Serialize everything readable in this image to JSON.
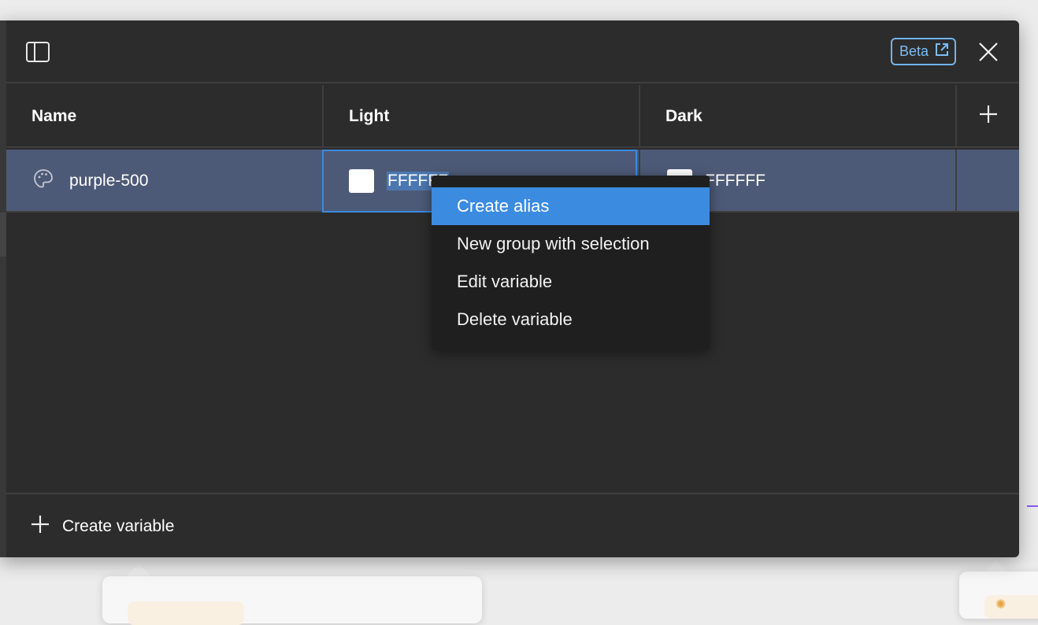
{
  "header": {
    "beta_label": "Beta",
    "icons": {
      "sidebar_toggle": "sidebar-panel-icon",
      "external_link": "external-link-icon",
      "close": "close-icon"
    }
  },
  "table": {
    "columns": [
      {
        "label": "Name"
      },
      {
        "label": "Light"
      },
      {
        "label": "Dark"
      }
    ],
    "add_column_icon": "plus-icon",
    "rows": [
      {
        "icon": "palette-icon",
        "name": "purple-500",
        "light": {
          "swatch_color": "#FFFFFF",
          "value": "FFFFFF"
        },
        "dark": {
          "swatch_color": "#FFFFFF",
          "value": "FFFFFF"
        }
      }
    ]
  },
  "footer": {
    "create_variable_label": "Create variable"
  },
  "context_menu": {
    "items": [
      {
        "label": "Create alias",
        "active": true
      },
      {
        "label": "New group with selection",
        "active": false
      },
      {
        "label": "Edit variable",
        "active": false
      },
      {
        "label": "Delete variable",
        "active": false
      }
    ]
  },
  "colors": {
    "panel_bg": "#2c2c2c",
    "selected_row": "#4d5a77",
    "accent_blue": "#3b8be0",
    "beta_blue": "#7ebcf3"
  }
}
